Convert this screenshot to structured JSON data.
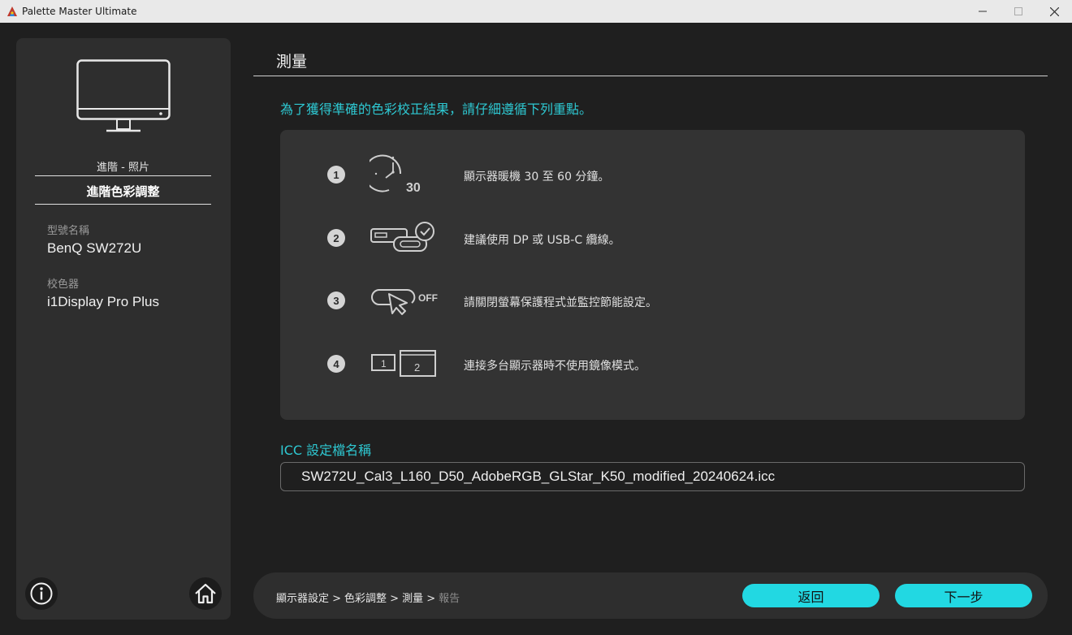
{
  "window": {
    "title": "Palette Master Ultimate"
  },
  "sidebar": {
    "profile_label": "進階 - 照片",
    "mode_label": "進階色彩調整",
    "model_label": "型號名稱",
    "model_value": "BenQ SW272U",
    "calibrator_label": "校色器",
    "calibrator_value": "i1Display Pro Plus"
  },
  "main": {
    "title": "測量",
    "instruction": "為了獲得準確的色彩校正結果，請仔細遵循下列重點。",
    "steps": [
      {
        "num": "1",
        "icon": "clock-30-icon",
        "text": "顯示器暖機 30 至 60 分鐘。"
      },
      {
        "num": "2",
        "icon": "cable-check-icon",
        "text": "建議使用 DP 或 USB-C 纜線。"
      },
      {
        "num": "3",
        "icon": "power-off-icon",
        "text": "請關閉螢幕保護程式並監控節能設定。"
      },
      {
        "num": "4",
        "icon": "multi-display-icon",
        "text": "連接多台顯示器時不使用鏡像模式。"
      }
    ],
    "icon_text": {
      "clock": "30",
      "off": "OFF",
      "display1": "1",
      "display2": "2"
    },
    "icc_label": "ICC 設定檔名稱",
    "icc_value": "SW272U_Cal3_L160_D50_AdobeRGB_GLStar_K50_modified_20240624.icc"
  },
  "bottom": {
    "breadcrumb": [
      "顯示器設定 >",
      "色彩調整 >",
      "測量 >",
      "報告"
    ],
    "back_label": "返回",
    "next_label": "下一步"
  },
  "colors": {
    "accent": "#22d8e2",
    "accent_text": "#2ec8d2",
    "background": "#1f1f1f",
    "panel": "#2e2e2e"
  }
}
